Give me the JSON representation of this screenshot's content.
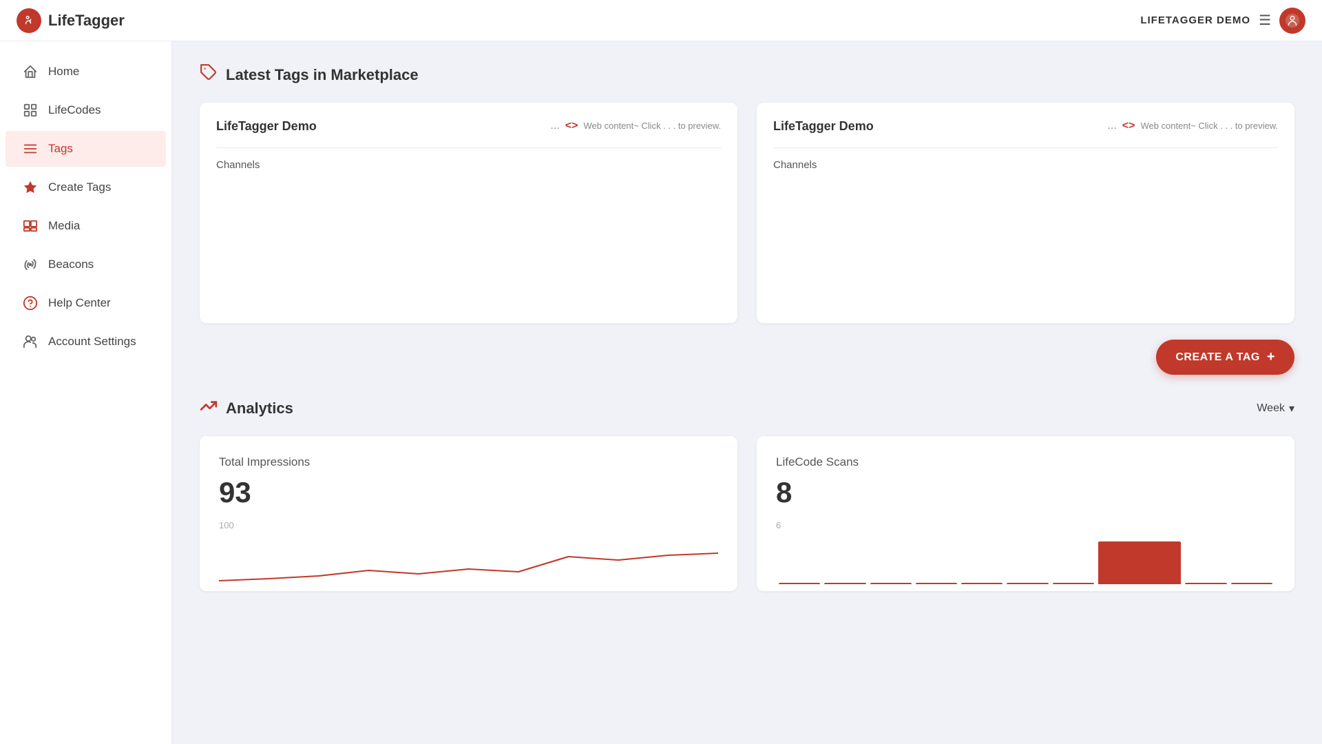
{
  "header": {
    "logo_text": "LifeTagger",
    "user_text": "LIFETAGGER DEMO",
    "logo_icon": "✋"
  },
  "sidebar": {
    "items": [
      {
        "id": "home",
        "label": "Home",
        "icon": "⌂",
        "active": false
      },
      {
        "id": "lifecodes",
        "label": "LifeCodes",
        "icon": "⊞",
        "active": false
      },
      {
        "id": "tags",
        "label": "Tags",
        "icon": "☰",
        "active": true
      },
      {
        "id": "create-tags",
        "label": "Create Tags",
        "icon": "★",
        "active": false
      },
      {
        "id": "media",
        "label": "Media",
        "icon": "❖",
        "active": false
      },
      {
        "id": "beacons",
        "label": "Beacons",
        "icon": "✤",
        "active": false
      },
      {
        "id": "help-center",
        "label": "Help Center",
        "icon": "?",
        "active": false
      },
      {
        "id": "account-settings",
        "label": "Account Settings",
        "icon": "👥",
        "active": false
      }
    ]
  },
  "marketplace": {
    "section_icon": "🏷",
    "section_title": "Latest Tags in Marketplace",
    "cards": [
      {
        "title": "LifeTagger Demo",
        "dots": "...",
        "code_icon": "‹›",
        "preview_text": "Web content~ Click . . . to preview.",
        "channels_label": "Channels"
      },
      {
        "title": "LifeTagger Demo",
        "dots": "...",
        "code_icon": "‹›",
        "preview_text": "Web content~ Click . . . to preview.",
        "channels_label": "Channels"
      }
    ]
  },
  "create_tag_btn": {
    "label": "CREATE A TAG",
    "icon": "+"
  },
  "analytics": {
    "section_icon": "〰",
    "section_title": "Analytics",
    "week_label": "Week",
    "dropdown_icon": "▾",
    "total_impressions": {
      "title": "Total Impressions",
      "value": "93",
      "scale": "100"
    },
    "lifecode_scans": {
      "title": "LifeCode Scans",
      "value": "8",
      "scale": "6",
      "bars": [
        0,
        0,
        0,
        0,
        0,
        0,
        0,
        0.9,
        0,
        0
      ]
    }
  }
}
